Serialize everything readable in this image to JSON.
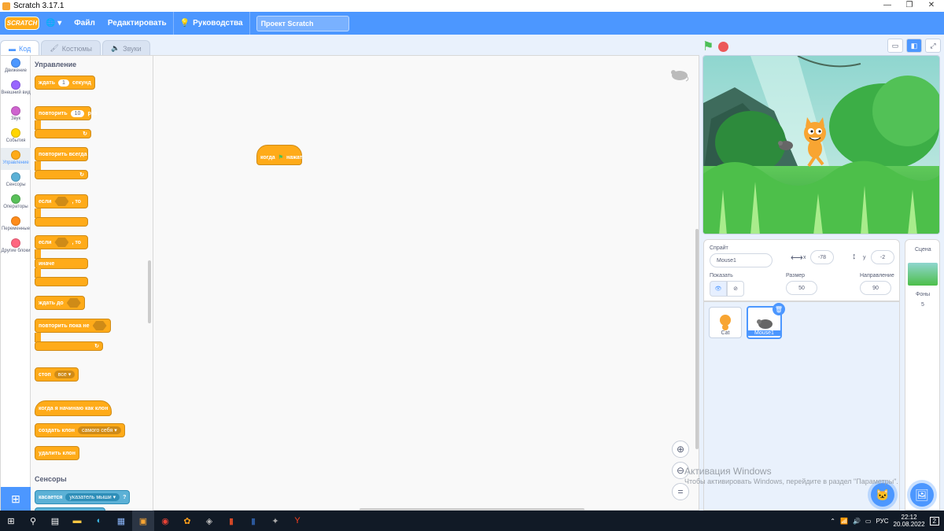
{
  "window": {
    "title": "Scratch 3.17.1",
    "minimize": "—",
    "maximize": "❐",
    "close": "✕"
  },
  "menubar": {
    "logo": "SCRATCH",
    "globe": "🌐 ▾",
    "file": "Файл",
    "edit": "Редактировать",
    "tutorials": "Руководства",
    "project_name": "Проект Scratch"
  },
  "tabs": [
    {
      "label": "Код",
      "icon": "code-icon"
    },
    {
      "label": "Костюмы",
      "icon": "brush-icon"
    },
    {
      "label": "Звуки",
      "icon": "speaker-icon"
    }
  ],
  "categories": [
    {
      "label": "Движение",
      "color": "#4c97ff"
    },
    {
      "label": "Внешний вид",
      "color": "#9966ff"
    },
    {
      "label": "Звук",
      "color": "#cf63cf"
    },
    {
      "label": "События",
      "color": "#ffd500"
    },
    {
      "label": "Управление",
      "color": "#ffab19"
    },
    {
      "label": "Сенсоры",
      "color": "#5cb1d6"
    },
    {
      "label": "Операторы",
      "color": "#59c059"
    },
    {
      "label": "Переменные",
      "color": "#ff8c1a"
    },
    {
      "label": "Другие блоки",
      "color": "#ff6680"
    }
  ],
  "palette": {
    "section_control": "Управление",
    "wait": "ждать",
    "wait_val": "1",
    "wait_unit": "секунд",
    "repeat": "повторить",
    "repeat_val": "10",
    "repeat_unit": "раз",
    "forever": "повторить всегда",
    "if": "если",
    "then": ", то",
    "if2": "если",
    "then2": ", то",
    "else": "иначе",
    "wait_until": "ждать до",
    "repeat_until": "повторить пока не",
    "stop": "стоп",
    "stop_opt": "все ▾",
    "when_clone": "когда я начинаю как клон",
    "create_clone": "создать клон",
    "create_clone_opt": "самого себя ▾",
    "delete_clone": "удалить клон",
    "section_sensing": "Сенсоры",
    "touching": "касается",
    "touching_opt": "указатель мыши ▾",
    "touching_q": "?"
  },
  "script": {
    "when_flag": "когда",
    "clicked": "нажат"
  },
  "stage_controls": {
    "flag": "green-flag-icon",
    "stop": "stop-icon"
  },
  "sprite_info": {
    "sprite_label": "Спрайт",
    "sprite_name": "Mouse1",
    "x_label": "x",
    "x_val": "-78",
    "y_label": "y",
    "y_val": "-2",
    "show_label": "Показать",
    "size_label": "Размер",
    "size_val": "50",
    "direction_label": "Направление",
    "direction_val": "90"
  },
  "sprites": [
    {
      "name": "Cat"
    },
    {
      "name": "Mouse1",
      "selected": true
    }
  ],
  "stage_pane": {
    "title": "Сцена",
    "backdrops_label": "Фоны",
    "backdrops_count": "5"
  },
  "watermark": {
    "line1": "Активация Windows",
    "line2": "Чтобы активировать Windows, перейдите в раздел \"Параметры\"."
  },
  "taskbar": {
    "lang": "РУС",
    "time": "22:12",
    "date": "20.08.2022",
    "notif": "2"
  },
  "colors": {
    "scratch_blue": "#4c97ff",
    "control": "#ffab19",
    "sensing": "#5cb1d6"
  }
}
